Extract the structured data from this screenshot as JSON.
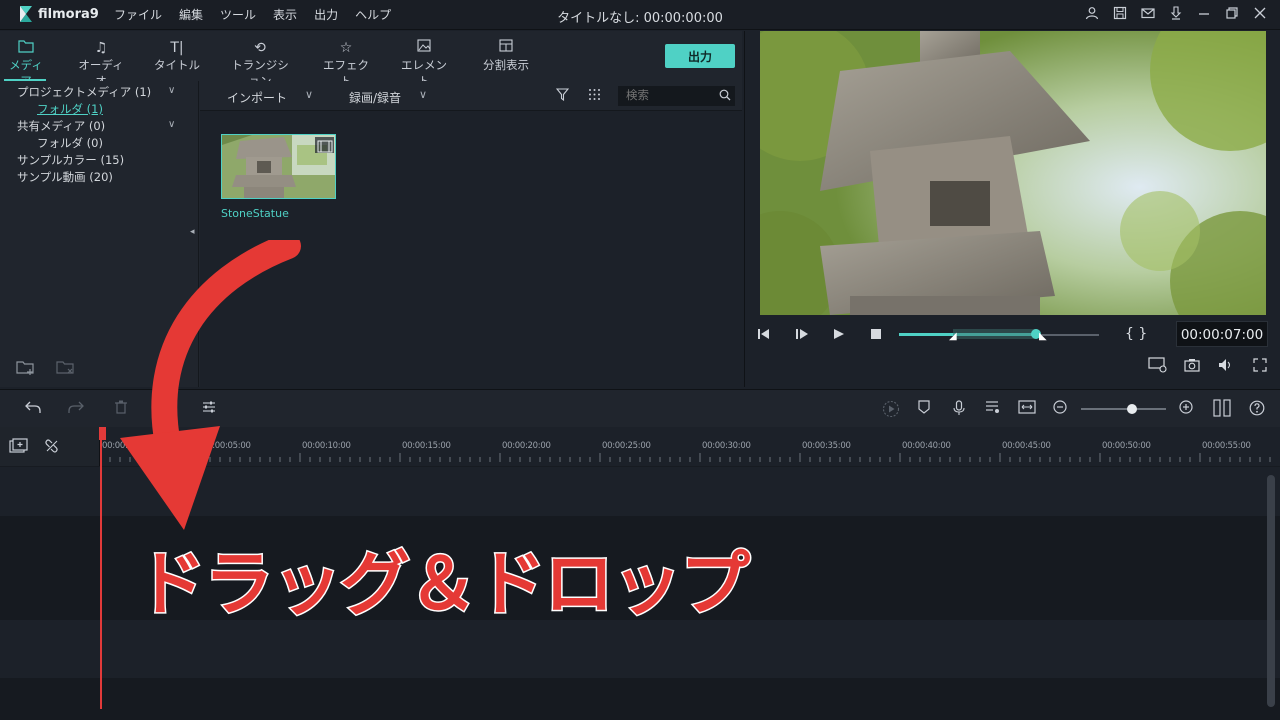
{
  "app": {
    "logo": "filmora9",
    "menu": [
      "ファイル",
      "編集",
      "ツール",
      "表示",
      "出力",
      "ヘルプ"
    ],
    "title": "タイトルなし: 00:00:00:00",
    "window_icons": [
      "user-icon",
      "save-icon",
      "mail-icon",
      "download-icon",
      "minimize-icon",
      "restore-icon",
      "close-icon"
    ]
  },
  "tabs": [
    {
      "label": "メディア",
      "icon": "folder-icon",
      "active": true
    },
    {
      "label": "オーディオ",
      "icon": "music-note-icon"
    },
    {
      "label": "タイトル",
      "icon": "text-icon"
    },
    {
      "label": "トランジション",
      "icon": "transition-icon"
    },
    {
      "label": "エフェクト",
      "icon": "effect-icon"
    },
    {
      "label": "エレメント",
      "icon": "image-icon"
    },
    {
      "label": "分割表示",
      "icon": "split-screen-icon"
    }
  ],
  "export_label": "出力",
  "sidebar": {
    "items": [
      {
        "label": "プロジェクトメディア (1)"
      },
      {
        "label": "フォルダ (1)",
        "selected": true
      },
      {
        "label": "共有メディア (0)"
      },
      {
        "label": "フォルダ (0)"
      },
      {
        "label": "サンプルカラー (15)"
      },
      {
        "label": "サンプル動画 (20)"
      }
    ]
  },
  "content": {
    "import_label": "インポート",
    "record_label": "録画/録音",
    "search_placeholder": "検索",
    "media": [
      {
        "name": "StoneStatue"
      }
    ]
  },
  "preview": {
    "timecode": "00:00:07:00",
    "brackets": "{ }",
    "progress": 0.0
  },
  "timeline": {
    "ticks": [
      "00:00:00:00",
      "00:00:05:00",
      "00:00:10:00",
      "00:00:15:00",
      "00:00:20:00",
      "00:00:25:00",
      "00:00:30:00",
      "00:00:35:00",
      "00:00:40:00",
      "00:00:45:00",
      "00:00:50:00",
      "00:00:55:00"
    ],
    "video_track_label": "1",
    "audio_track_label": "1"
  },
  "overlay_text": "ドラッグ＆ドロップ",
  "colors": {
    "accent": "#4fd1c5",
    "overlay": "#e53935",
    "playhead": "#e23a3a"
  }
}
